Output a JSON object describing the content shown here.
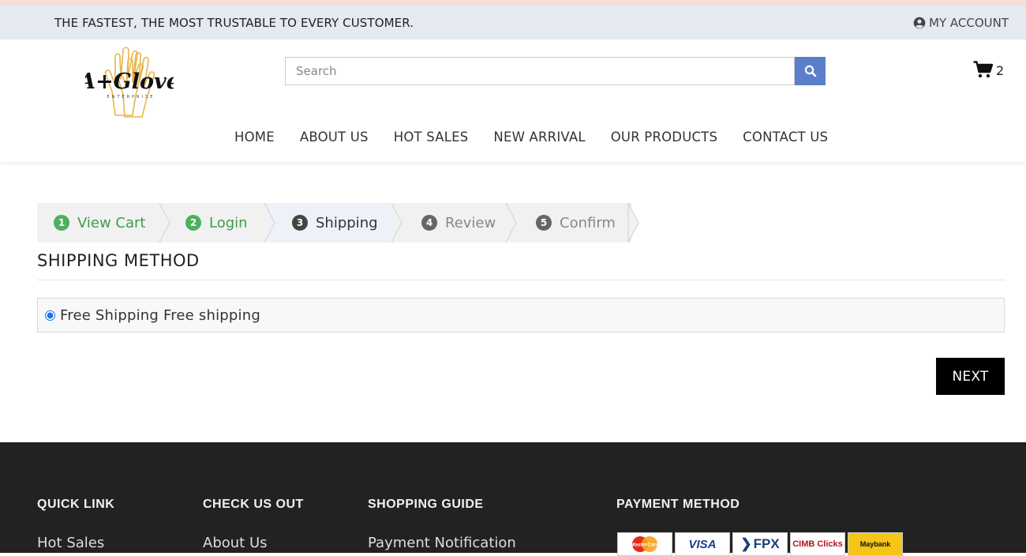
{
  "topbar": {
    "tagline": "THE FASTEST, THE MOST TRUSTABLE TO EVERY CUSTOMER.",
    "account_label": "MY ACCOUNT"
  },
  "header": {
    "logo_text": "A+Glove",
    "logo_sub": "ENTERPRISE",
    "search_placeholder": "Search",
    "cart_count": "2"
  },
  "nav": [
    "HOME",
    "ABOUT US",
    "HOT SALES",
    "NEW ARRIVAL",
    "OUR PRODUCTS",
    "CONTACT US"
  ],
  "steps": [
    {
      "num": "1",
      "label": "View Cart",
      "state": "done"
    },
    {
      "num": "2",
      "label": "Login",
      "state": "done"
    },
    {
      "num": "3",
      "label": "Shipping",
      "state": "active"
    },
    {
      "num": "4",
      "label": "Review",
      "state": "pending"
    },
    {
      "num": "5",
      "label": "Confirm",
      "state": "pending"
    }
  ],
  "shipping": {
    "title": "SHIPPING METHOD",
    "option_label": "Free Shipping Free shipping",
    "next_label": "NEXT"
  },
  "footer": {
    "quick_link_title": "QUICK LINK",
    "quick_link_first": "Hot Sales",
    "check_us_out_title": "CHECK US OUT",
    "check_us_out_first": "About Us",
    "shopping_guide_title": "SHOPPING GUIDE",
    "shopping_guide_first": "Payment Notification",
    "payment_method_title": "PAYMENT METHOD",
    "payment_logos": [
      "MasterCard",
      "VISA",
      "FPX",
      "CIMB Clicks",
      "Maybank"
    ]
  },
  "colors": {
    "topbar_bg": "#e4e9f2",
    "search_button": "#5b7fcc",
    "step_done": "#4cb05c",
    "footer_bg": "#222222"
  }
}
